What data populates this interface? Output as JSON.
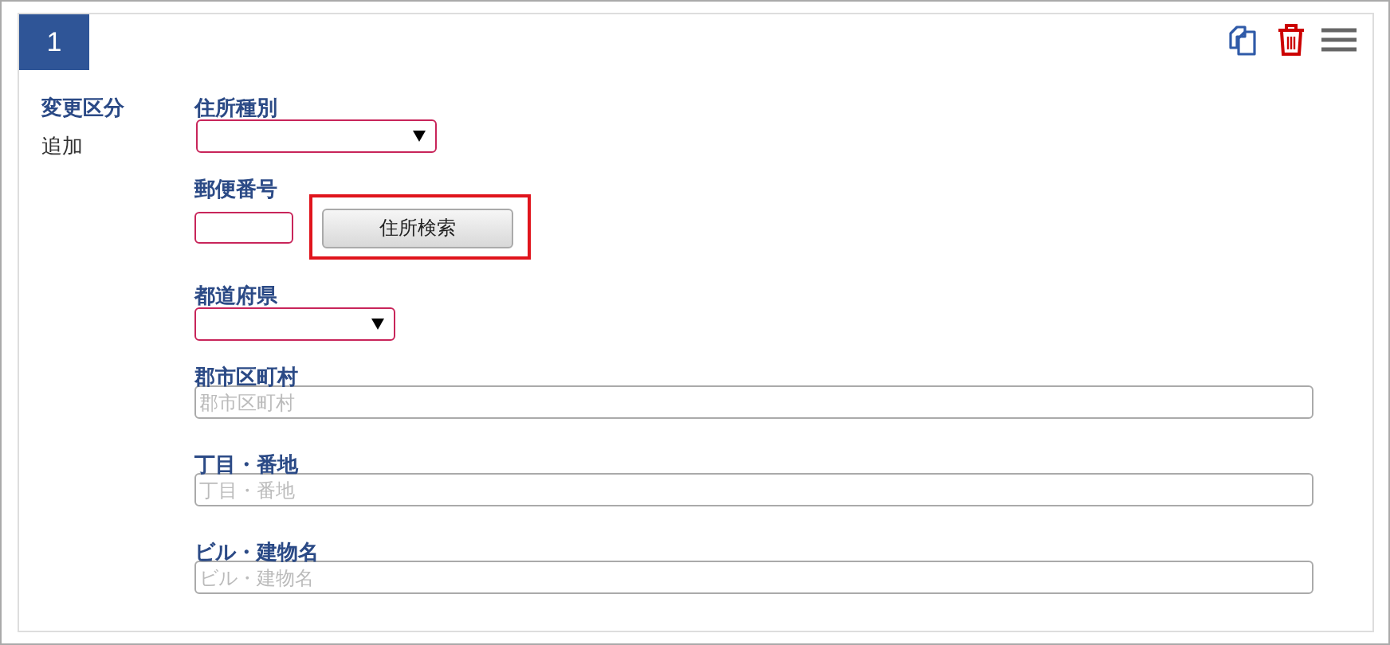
{
  "card": {
    "index": "1"
  },
  "change_type": {
    "label": "変更区分",
    "value": "追加"
  },
  "fields": [
    {
      "kind": "select",
      "label": "住所種別"
    },
    {
      "kind": "postal",
      "label": "郵便番号",
      "button": "住所検索",
      "highlighted": true
    },
    {
      "kind": "select",
      "label": "都道府県"
    },
    {
      "kind": "text",
      "label": "郡市区町村",
      "placeholder": "郡市区町村"
    },
    {
      "kind": "text",
      "label": "丁目・番地",
      "placeholder": "丁目・番地"
    },
    {
      "kind": "text",
      "label": "ビル・建物名",
      "placeholder": "ビル・建物名"
    }
  ]
}
